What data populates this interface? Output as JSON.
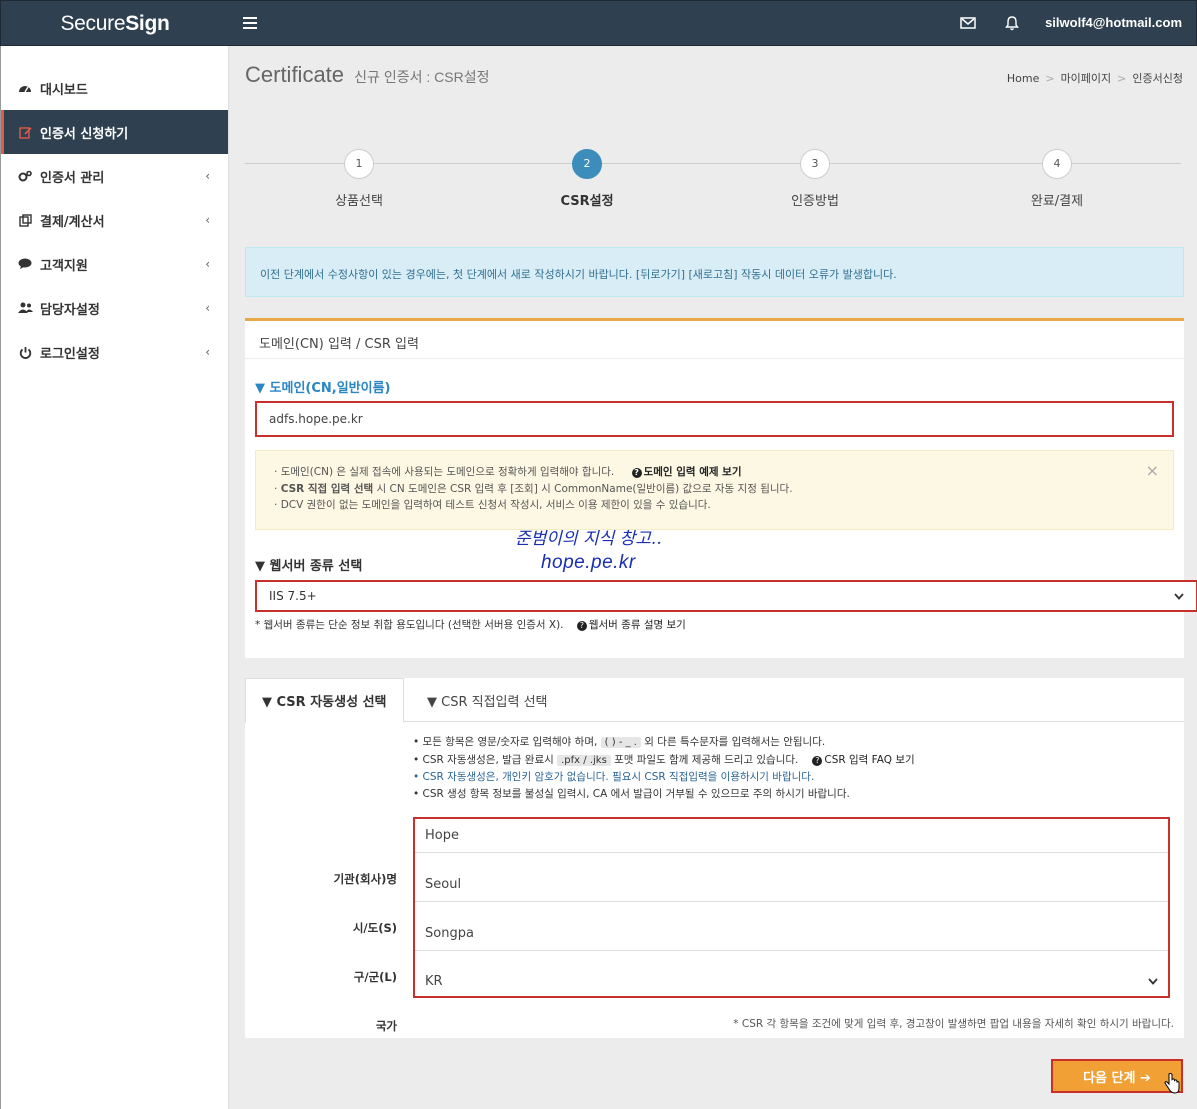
{
  "header": {
    "logo_text_1": "Secure",
    "logo_text_2": "Sign",
    "menu_icon": "hamburger-icon",
    "user_email": "silwolf4@hotmail.com"
  },
  "sidebar": {
    "items": [
      {
        "label": "대시보드",
        "icon": "dashboard-icon"
      },
      {
        "label": "인증서 신청하기",
        "icon": "edit-icon",
        "active": true
      },
      {
        "label": "인증서 관리",
        "icon": "gears-icon"
      },
      {
        "label": "결제/계산서",
        "icon": "copy-icon"
      },
      {
        "label": "고객지원",
        "icon": "chat-icon"
      },
      {
        "label": "담당자설정",
        "icon": "users-icon"
      },
      {
        "label": "로그인설정",
        "icon": "power-icon"
      }
    ],
    "chevron": "‹"
  },
  "page": {
    "title": "Certificate",
    "subtitle": "신규 인증서 : CSR설정",
    "breadcrumb": [
      "Home",
      "마이페이지",
      "인증서신청"
    ],
    "breadcrumb_sep": ">"
  },
  "stepper": {
    "steps": [
      {
        "num": "1",
        "label": "상품선택"
      },
      {
        "num": "2",
        "label": "CSR설정",
        "active": true
      },
      {
        "num": "3",
        "label": "인증방법"
      },
      {
        "num": "4",
        "label": "완료/결제"
      }
    ]
  },
  "notice_top": "이전 단계에서 수정사항이 있는 경우에는, 첫 단계에서 새로 작성하시기 바랍니다. [뒤로가기] [새로고침] 작동시 데이터 오류가 발생합니다.",
  "domain_panel": {
    "heading": "도메인(CN) 입력 / CSR 입력",
    "domain_label": "▼ 도메인(CN,일반이름)",
    "domain_value": "adfs.hope.pe.kr",
    "notes": {
      "line1": "도메인(CN) 은 실제 접속에 사용되는 도메인으로 정확하게 입력해야 합니다.",
      "line1_link": "도메인 입력 예제 보기",
      "line2_bold": "CSR 직접 입력 선택",
      "line2_rest": " 시 CN 도메인은 CSR 입력 후 [조회] 시 CommonName(일반이름) 값으로 자동 지정 됩니다.",
      "line3": "DCV 권한이 없는 도메인을 입력하여 테스트 신청서 작성시, 서비스 이용 제한이 있을 수 있습니다.",
      "bullet": "·",
      "close": "×"
    },
    "watermark_line1": "준범이의 지식 창고..",
    "watermark_line2": "hope.pe.kr",
    "server_label": "▼ 웹서버 종류 선택",
    "server_value": "IIS 7.5+",
    "server_note": "* 웹서버 종류는 단순 정보 취합 용도입니다 (선택한 서버용 인증서 X).",
    "server_help": "웹서버 종류 설명 보기"
  },
  "csr_panel": {
    "tabs": [
      "▼ CSR 자동생성 선택",
      "▼ CSR 직접입력 선택"
    ],
    "rules": {
      "r1_a": "• 모든 항목은 영문/숫자로 입력해야 하며, ",
      "r1_code": "( ) - _ .",
      "r1_b": " 외 다른 특수문자를 입력해서는 안됩니다.",
      "r2_a": "• CSR 자동생성은, 발급 완료시 ",
      "r2_code": ".pfx / .jks",
      "r2_b": " 포맷 파일도 함께 제공해 드리고 있습니다.",
      "r2_link": "CSR 입력 FAQ 보기",
      "r3": "• CSR 자동생성은, 개인키 암호가 없습니다. 필요시 CSR 직접입력을 이용하시기 바랍니다.",
      "r4": "• CSR 생성 항목 정보를 불성실 입력시, CA 에서 발급이 거부될 수 있으므로 주의 하시기 바랍니다."
    },
    "fields": [
      {
        "label": "기관(회사)명",
        "value": "Hope"
      },
      {
        "label": "시/도(S)",
        "value": "Seoul"
      },
      {
        "label": "구/군(L)",
        "value": "Songpa"
      },
      {
        "label": "국가",
        "value": "KR"
      }
    ],
    "foot_note": "* CSR 각 항목을 조건에 맞게 입력 후, 경고창이 발생하면 팝업 내용을 자세히 확인 하시기 바랍니다."
  },
  "next_button": "다음 단계 ➔"
}
